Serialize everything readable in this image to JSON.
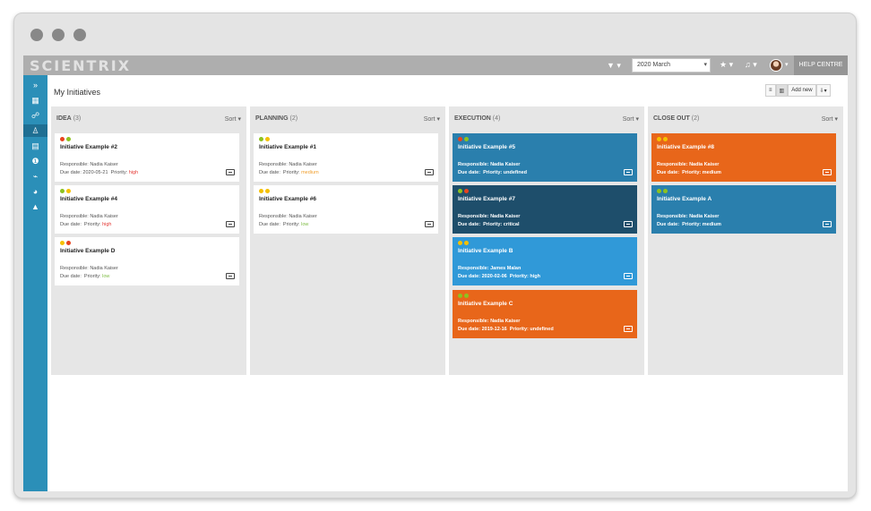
{
  "app": {
    "logo": "SCIENTRIX",
    "topbar": {
      "filter_label": "▼ ▾",
      "period": "2020 March",
      "period_caret": "▾",
      "star_label": "★ ▾",
      "bell_label": "♫ ▾",
      "avatar_caret": "▾",
      "help": "HELP CENTRE"
    },
    "sidebar_icons": [
      "expand-icon",
      "grid-icon",
      "group-icon",
      "org-chart-icon",
      "card-view-icon",
      "help-circle-icon",
      "chart-icon",
      "pie-chart-icon",
      "warning-icon"
    ],
    "sidebar_glyphs": [
      "»",
      "▦",
      "☍",
      "♙",
      "▤",
      "❶",
      "⌁",
      "◕",
      "▲"
    ]
  },
  "page": {
    "title": "My Initiatives",
    "view_list": "≡",
    "view_board": "▥",
    "add_new": "Add new",
    "download": "⇩▾"
  },
  "labels": {
    "sort": "Sort ▾",
    "responsible": "Responsible:",
    "due_date": "Due date:",
    "priority": "Priority:"
  },
  "colors": {
    "sidebar": "#2b8fb8",
    "red": "#e8431e",
    "amber": "#f5c000",
    "green": "#8dc21f",
    "priority_high": "#e53935",
    "priority_medium": "#f0a030",
    "priority_low": "#7dbb42",
    "card_blue": "#2a7fad",
    "card_dark": "#1e4e6b",
    "card_lightblue": "#3099d8",
    "card_orange": "#e8661a"
  },
  "columns": [
    {
      "title": "IDEA",
      "count": "(3)",
      "cards": [
        {
          "title": "Initiative Example #2",
          "responsible": "Nadia Kaiser",
          "due_date": "2020-05-21",
          "priority": "high",
          "lights": [
            "red",
            "green"
          ],
          "bg": "white"
        },
        {
          "title": "Initiative Example #4",
          "responsible": "Nadia Kaiser",
          "due_date": "",
          "priority": "high",
          "lights": [
            "green",
            "amber"
          ],
          "bg": "white"
        },
        {
          "title": "Initiative Example D",
          "responsible": "Nadia Kaiser",
          "due_date": "",
          "priority": "low",
          "lights": [
            "amber",
            "red"
          ],
          "bg": "white"
        }
      ]
    },
    {
      "title": "PLANNING",
      "count": "(2)",
      "cards": [
        {
          "title": "Initiative Example #1",
          "responsible": "Nadia Kaiser",
          "due_date": "",
          "priority": "medium",
          "lights": [
            "green",
            "amber"
          ],
          "bg": "white"
        },
        {
          "title": "Initiative Example #6",
          "responsible": "Nadia Kaiser",
          "due_date": "",
          "priority": "low",
          "lights": [
            "amber",
            "amber"
          ],
          "bg": "white"
        }
      ]
    },
    {
      "title": "EXECUTION",
      "count": "(4)",
      "cards": [
        {
          "title": "Initiative Example #5",
          "responsible": "Nadia Kaiser",
          "due_date": "",
          "priority": "undefined",
          "lights": [
            "red",
            "green"
          ],
          "bg": "card_blue"
        },
        {
          "title": "Initiative Example #7",
          "responsible": "Nadia Kaiser",
          "due_date": "",
          "priority": "critical",
          "lights": [
            "green",
            "red"
          ],
          "bg": "card_dark"
        },
        {
          "title": "Initiative Example B",
          "responsible": "James Malan",
          "due_date": "2020-02-06",
          "priority": "high",
          "lights": [
            "amber",
            "amber"
          ],
          "bg": "card_lightblue"
        },
        {
          "title": "Initiative Example C",
          "responsible": "Nadia Kaiser",
          "due_date": "2019-12-16",
          "priority": "undefined",
          "lights": [
            "green",
            "green"
          ],
          "bg": "card_orange"
        }
      ]
    },
    {
      "title": "CLOSE OUT",
      "count": "(2)",
      "cards": [
        {
          "title": "Initiative Example #8",
          "responsible": "Nadia Kaiser",
          "due_date": "",
          "priority": "medium",
          "lights": [
            "amber",
            "amber"
          ],
          "bg": "card_orange"
        },
        {
          "title": "Initiative Example A",
          "responsible": "Nadia Kaiser",
          "due_date": "",
          "priority": "medium",
          "lights": [
            "green",
            "green"
          ],
          "bg": "card_blue"
        }
      ]
    }
  ]
}
